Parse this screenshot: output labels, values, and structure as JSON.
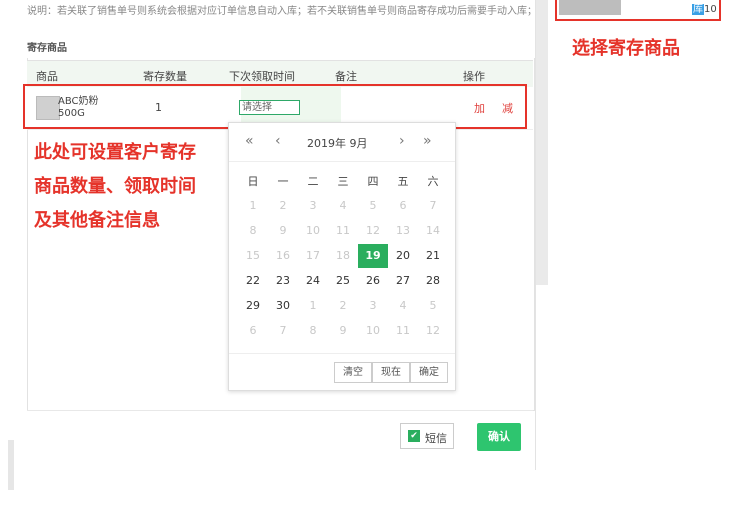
{
  "note": "说明：若关联了销售单号则系统会根据对应订单信息自动入库；若不关联销售单号则商品寄存成功后需要手动入库；",
  "section_title": "寄存商品",
  "table": {
    "headers": [
      "商品",
      "寄存数量",
      "下次领取时间",
      "备注",
      "操作"
    ],
    "row": {
      "product_line1": "ABC奶粉",
      "product_line2": "500G",
      "quantity": "1",
      "date_placeholder": "请选择",
      "add": "加",
      "subtract": "减"
    }
  },
  "annotations": {
    "left": [
      "此处可设置客户寄存",
      "商品数量、领取时间",
      "及其他备注信息"
    ],
    "right": "选择寄存商品"
  },
  "stock": {
    "prefix": "库",
    "value": "10"
  },
  "calendar": {
    "title": "2019年  9月",
    "nav": {
      "prev_year": "«",
      "prev_month": "‹",
      "next_month": "›",
      "next_year": "»"
    },
    "weekdays": [
      "日",
      "一",
      "二",
      "三",
      "四",
      "五",
      "六"
    ],
    "weeks": [
      [
        {
          "d": "1",
          "t": "other"
        },
        {
          "d": "2",
          "t": "other"
        },
        {
          "d": "3",
          "t": "other"
        },
        {
          "d": "4",
          "t": "other"
        },
        {
          "d": "5",
          "t": "other"
        },
        {
          "d": "6",
          "t": "other"
        },
        {
          "d": "7",
          "t": "other"
        }
      ],
      [
        {
          "d": "8",
          "t": "other"
        },
        {
          "d": "9",
          "t": "other"
        },
        {
          "d": "10",
          "t": "other"
        },
        {
          "d": "11",
          "t": "other"
        },
        {
          "d": "12",
          "t": "other"
        },
        {
          "d": "13",
          "t": "other"
        },
        {
          "d": "14",
          "t": "other"
        }
      ],
      [
        {
          "d": "15",
          "t": "other"
        },
        {
          "d": "16",
          "t": "other"
        },
        {
          "d": "17",
          "t": "other"
        },
        {
          "d": "18",
          "t": "other"
        },
        {
          "d": "19",
          "t": "sel"
        },
        {
          "d": "20",
          "t": "cur"
        },
        {
          "d": "21",
          "t": "cur"
        }
      ],
      [
        {
          "d": "22",
          "t": "cur"
        },
        {
          "d": "23",
          "t": "cur"
        },
        {
          "d": "24",
          "t": "cur"
        },
        {
          "d": "25",
          "t": "cur"
        },
        {
          "d": "26",
          "t": "cur"
        },
        {
          "d": "27",
          "t": "cur"
        },
        {
          "d": "28",
          "t": "cur"
        }
      ],
      [
        {
          "d": "29",
          "t": "cur"
        },
        {
          "d": "30",
          "t": "cur"
        },
        {
          "d": "1",
          "t": "other"
        },
        {
          "d": "2",
          "t": "other"
        },
        {
          "d": "3",
          "t": "other"
        },
        {
          "d": "4",
          "t": "other"
        },
        {
          "d": "5",
          "t": "other"
        }
      ],
      [
        {
          "d": "6",
          "t": "other"
        },
        {
          "d": "7",
          "t": "other"
        },
        {
          "d": "8",
          "t": "other"
        },
        {
          "d": "9",
          "t": "other"
        },
        {
          "d": "10",
          "t": "other"
        },
        {
          "d": "11",
          "t": "other"
        },
        {
          "d": "12",
          "t": "other"
        }
      ]
    ],
    "buttons": {
      "clear": "清空",
      "now": "现在",
      "ok": "确定"
    }
  },
  "footer": {
    "sms_label": "短信",
    "sms_checked": true,
    "confirm_label": "确认"
  },
  "colors": {
    "accent_green": "#2aae5e",
    "annotation_red": "#e5332a",
    "action_red": "#e0413d"
  }
}
